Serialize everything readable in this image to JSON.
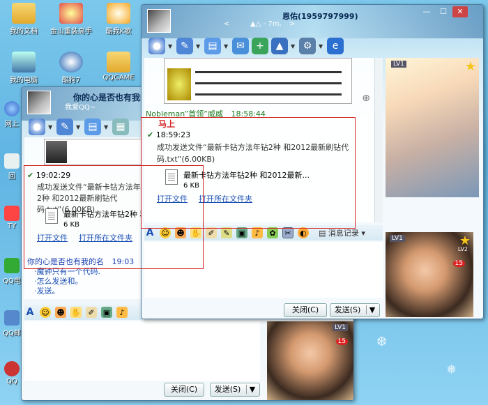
{
  "desktop": {
    "icons": [
      {
        "label": "我的文档",
        "color": "#f2c94c"
      },
      {
        "label": "金山重装高手",
        "color": "#e14b4b"
      },
      {
        "label": "酷我K歌",
        "color": "#f6a623"
      },
      {
        "label": "我的电脑",
        "color": "#6aa6e0"
      },
      {
        "label": "酷狗7",
        "color": "#1b5fb0"
      },
      {
        "label": "QQGAME",
        "color": "#f2c94c"
      },
      {
        "label": "网上",
        "color": "#3c8de0"
      },
      {
        "label": "回",
        "color": "#6ea"
      },
      {
        "label": "TY",
        "color": "#f44"
      },
      {
        "label": "QQ电",
        "color": "#3a3"
      },
      {
        "label": "QQ邮",
        "color": "#58c"
      },
      {
        "label": "QQ",
        "color": "#c33"
      }
    ]
  },
  "back_window": {
    "title": "你的心是否也有我的",
    "subtitle": "我爱QQ~",
    "messages": [
      {
        "time": "19:02:29"
      },
      {
        "text": "成功发送文件“最新卡钻方法年钻2种 和2012最新刷钻代码.txt”(6.00KB)"
      }
    ],
    "file": {
      "name": "最新卡钻方法年钻2种 和2",
      "size": "6 KB"
    },
    "links": [
      "打开文件",
      "打开所在文件夹"
    ],
    "incoming": {
      "sender": "你的心是否也有我的名",
      "time": "19:03",
      "lines": [
        "·魔钟只有一个代码.",
        "·怎么发送和。",
        "·发送。"
      ]
    },
    "buttons": {
      "close": "关闭(C)",
      "send": "发送(S)"
    }
  },
  "front_window": {
    "title": "恩佑(1959797999)",
    "status": "▲△ - 7m,",
    "controls": {
      "min": "—",
      "max": "☐",
      "close": "✕"
    },
    "earlier_sender": "Nobleman”首领”威威",
    "earlier_time": "18:58:44",
    "annotation": "马上",
    "time": "18:59:23",
    "message": "成功发送文件“最新卡钻方法年钻2种 和2012最新刷钻代码.txt”(6.00KB)",
    "file": {
      "name": "最新卡钻方法年钻2种 和2012最新...",
      "size": "6 KB"
    },
    "links": [
      "打开文件",
      "打开所在文件夹"
    ],
    "msg_record": "消息记录",
    "buttons": {
      "close": "关闭(C)",
      "send": "发送(S)"
    },
    "badges": {
      "lv1": "LV1",
      "lv2": "LV2",
      "num": "15"
    }
  },
  "colors": {
    "accent": "#1a4fb3",
    "red_box": "#d32424",
    "green": "#1f7a1f"
  }
}
